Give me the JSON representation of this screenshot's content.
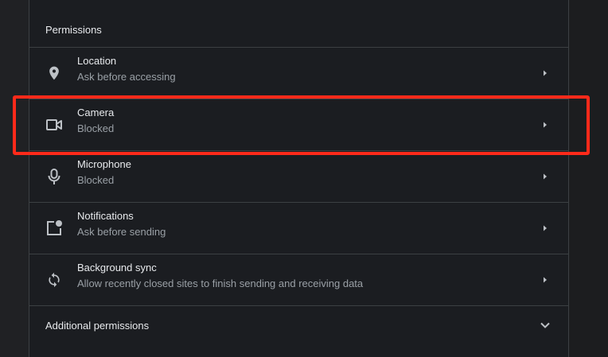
{
  "section": {
    "title": "Permissions"
  },
  "permissions": [
    {
      "icon": "location-pin-icon",
      "label": "Location",
      "sublabel": "Ask before accessing"
    },
    {
      "icon": "video-camera-icon",
      "label": "Camera",
      "sublabel": "Blocked"
    },
    {
      "icon": "microphone-icon",
      "label": "Microphone",
      "sublabel": "Blocked"
    },
    {
      "icon": "notification-icon",
      "label": "Notifications",
      "sublabel": "Ask before sending"
    },
    {
      "icon": "sync-icon",
      "label": "Background sync",
      "sublabel": "Allow recently closed sites to finish sending and receiving data"
    }
  ],
  "additional": {
    "label": "Additional permissions",
    "icon": "chevron-down-icon"
  },
  "colors": {
    "highlight": "#ff2a1a",
    "background": "#1b1d21",
    "text_primary": "#e8eaed",
    "text_secondary": "#9aa0a6",
    "divider": "#3c4043"
  }
}
